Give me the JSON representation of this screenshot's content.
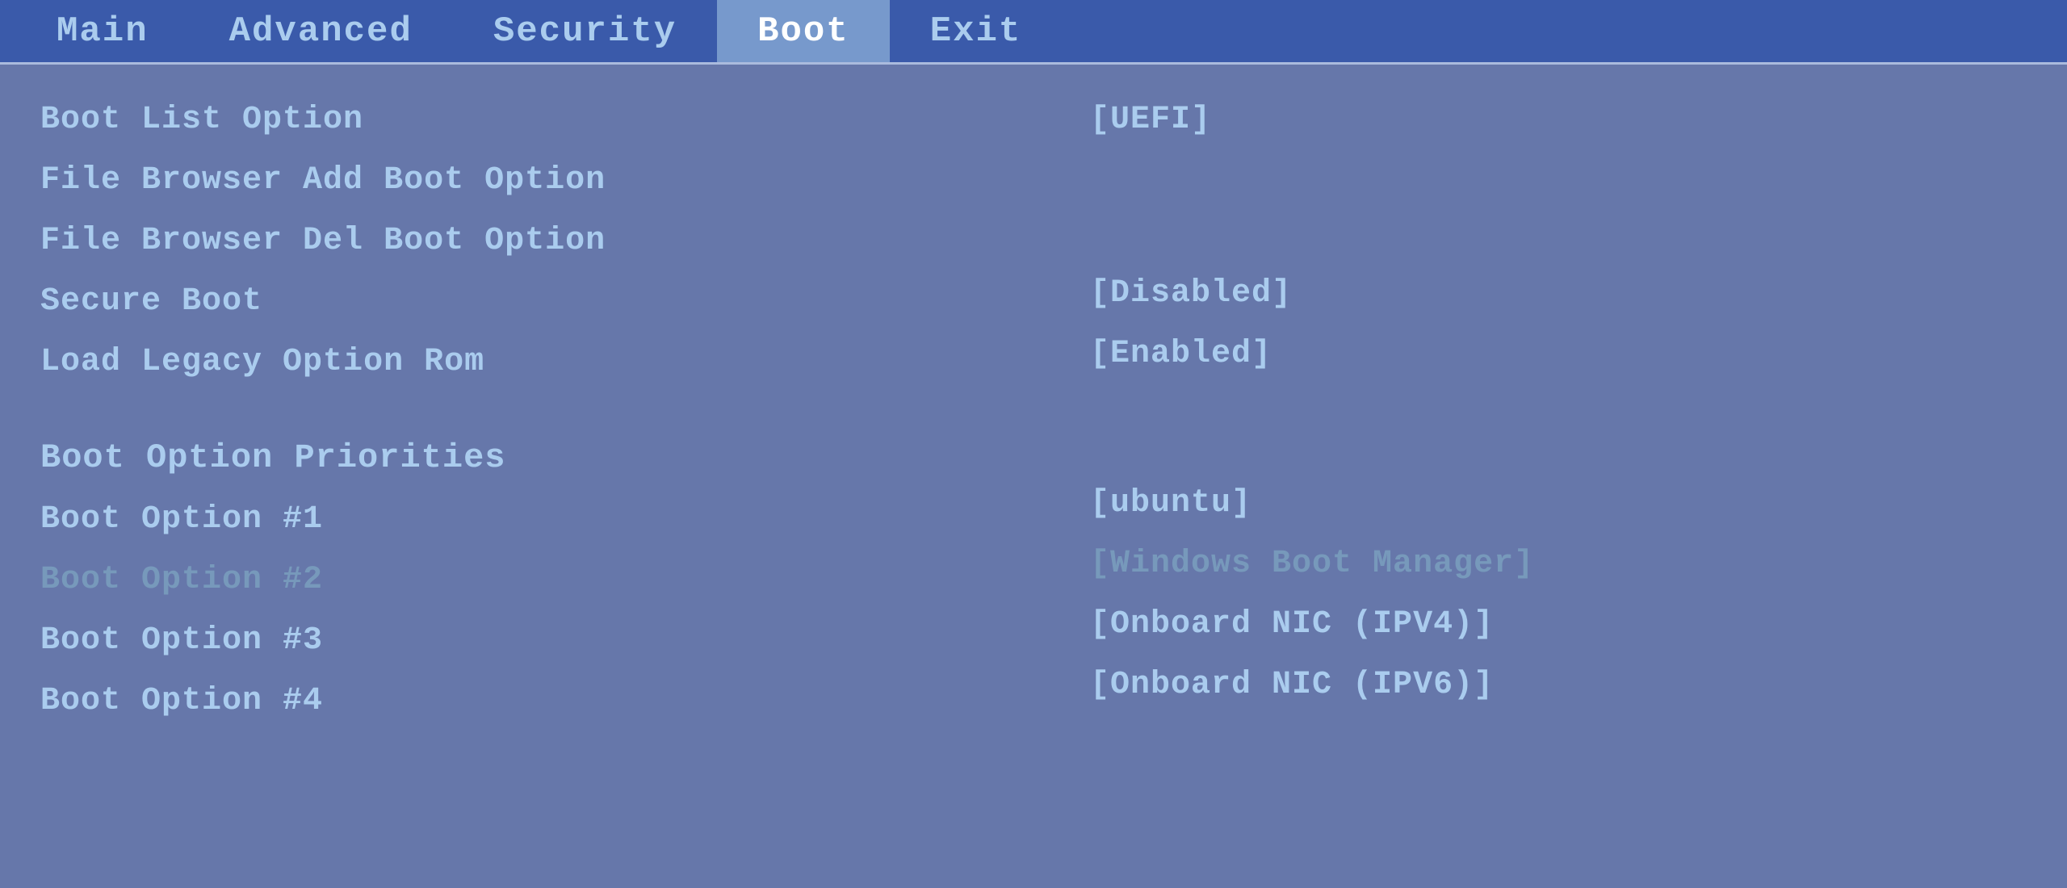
{
  "menu": {
    "tabs": [
      {
        "id": "main",
        "label": "Main",
        "active": false
      },
      {
        "id": "advanced",
        "label": "Advanced",
        "active": false
      },
      {
        "id": "security",
        "label": "Security",
        "active": false
      },
      {
        "id": "boot",
        "label": "Boot",
        "active": true
      },
      {
        "id": "exit",
        "label": "Exit",
        "active": false
      }
    ]
  },
  "boot": {
    "left_items": [
      {
        "id": "boot-list-option",
        "label": "Boot List Option",
        "faded": false
      },
      {
        "id": "file-browser-add",
        "label": "File Browser Add Boot Option",
        "faded": false
      },
      {
        "id": "file-browser-del",
        "label": "File Browser Del Boot Option",
        "faded": false
      },
      {
        "id": "secure-boot",
        "label": "Secure Boot",
        "faded": false
      },
      {
        "id": "load-legacy",
        "label": "Load Legacy Option Rom",
        "faded": false
      },
      {
        "id": "boot-priorities-header",
        "label": "Boot Option Priorities",
        "faded": false,
        "header": true
      },
      {
        "id": "boot-option-1",
        "label": "Boot Option #1",
        "faded": false
      },
      {
        "id": "boot-option-2",
        "label": "Boot Option #2",
        "faded": true
      },
      {
        "id": "boot-option-3",
        "label": "Boot Option #3",
        "faded": false
      },
      {
        "id": "boot-option-4",
        "label": "Boot Option #4",
        "faded": false
      }
    ],
    "right_values": [
      {
        "id": "val-uefi",
        "label": "[UEFI]",
        "row": 0
      },
      {
        "id": "val-disabled",
        "label": "[Disabled]",
        "row": 3
      },
      {
        "id": "val-enabled",
        "label": "[Enabled]",
        "row": 4
      },
      {
        "id": "val-ubuntu",
        "label": "[ubuntu]",
        "row": 6
      },
      {
        "id": "val-windows",
        "label": "[Windows Boot Manager]",
        "row": 7
      },
      {
        "id": "val-nic-ipv4",
        "label": "[Onboard NIC (IPV4)]",
        "row": 8
      },
      {
        "id": "val-nic-ipv6",
        "label": "[Onboard NIC (IPV6)]",
        "row": 9
      }
    ]
  }
}
